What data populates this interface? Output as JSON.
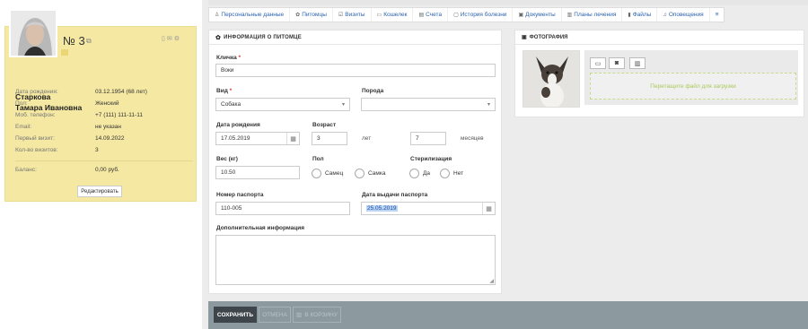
{
  "client": {
    "number": "№ 3",
    "last_name": "Старкова",
    "first_name": "Тамара Ивановна",
    "fields": [
      {
        "label": "Дата рождения:",
        "value": "03.12.1954 (68 лет)"
      },
      {
        "label": "Пол:",
        "value": "Женский"
      },
      {
        "label": "Моб. телефон:",
        "value": "+7 (111) 111-11-11"
      },
      {
        "label": "Email:",
        "value": "не указан"
      },
      {
        "label": "Первый визит:",
        "value": "14.09.2022"
      },
      {
        "label": "Кол-во визитов:",
        "value": "3"
      }
    ],
    "balance_label": "Баланс:",
    "balance_value": "0,00 руб.",
    "edit_label": "Редактировать"
  },
  "tabs": [
    {
      "label": "Персональные данные",
      "icon": "person-icon"
    },
    {
      "label": "Питомцы",
      "icon": "paw-icon"
    },
    {
      "label": "Визиты",
      "icon": "calendar-check-icon"
    },
    {
      "label": "Кошелек",
      "icon": "wallet-icon"
    },
    {
      "label": "Счета",
      "icon": "invoice-icon"
    },
    {
      "label": "История болезни",
      "icon": "history-icon"
    },
    {
      "label": "Документы",
      "icon": "documents-icon"
    },
    {
      "label": "Планы лечения",
      "icon": "plan-icon"
    },
    {
      "label": "Файлы",
      "icon": "file-icon"
    },
    {
      "label": "Оповещения",
      "icon": "bell-icon"
    }
  ],
  "pet": {
    "section_title": "ИНФОРМАЦИЯ О ПИТОМЦЕ",
    "nickname_label": "Кличка",
    "nickname_value": "Воки",
    "species_label": "Вид",
    "species_value": "Собака",
    "breed_label": "Порода",
    "breed_value": "",
    "birth_label": "Дата рождения",
    "birth_value": "17.05.2019",
    "age_label": "Возраст",
    "age_years": "3",
    "age_years_unit": "лет",
    "age_months": "7",
    "age_months_unit": "месяцев",
    "weight_label": "Вес (кг)",
    "weight_value": "10.50",
    "sex_label": "Пол",
    "sex_options": [
      "Самец",
      "Самка"
    ],
    "sterilization_label": "Стерилизация",
    "sterilization_options": [
      "Да",
      "Нет"
    ],
    "passport_label": "Номер паспорта",
    "passport_value": "110-005",
    "passport_date_label": "Дата выдачи паспорта",
    "passport_date_value": "25.05.2019",
    "notes_label": "Дополнительная информация",
    "notes_value": ""
  },
  "photo": {
    "section_title": "ФОТОГРАФИЯ",
    "drop_text": "Перетащите файл для загрузки"
  },
  "footer": {
    "save": "СОХРАНИТЬ",
    "cancel": "ОТМЕНА",
    "trash": "В КОРЗИНУ"
  }
}
